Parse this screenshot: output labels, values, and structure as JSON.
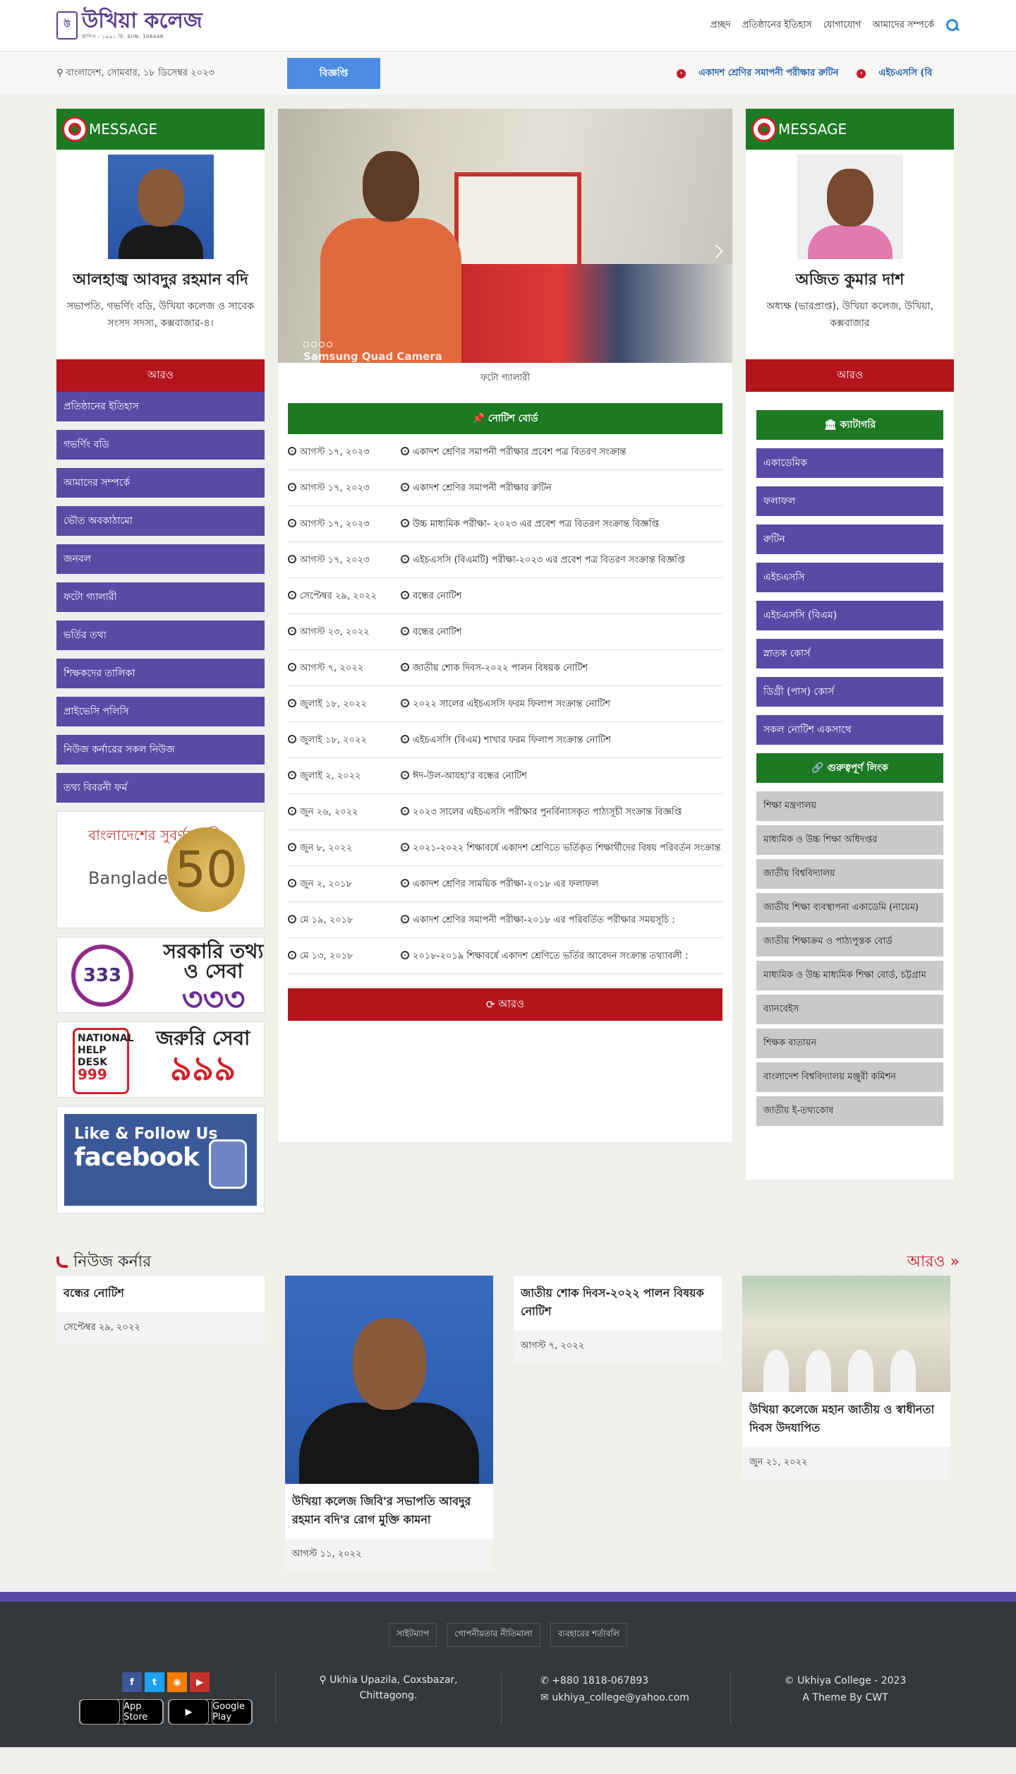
{
  "header": {
    "logo_text": "উখিয়া কলেজ",
    "logo_sub": "স্থাপিত - ১৯৯১ খ্রি. EIIN: 106446",
    "nav": [
      "প্রচ্ছদ",
      "প্রতিষ্ঠানের ইতিহাস",
      "যোগাযোগ",
      "আমাদের সম্পর্কে"
    ]
  },
  "strip": {
    "date": "বাংলাদেশ, সোমবার, ১৮ ডিসেম্বর ২০২৩",
    "badge": "বিজ্ঞপ্তি",
    "marquee": [
      "একাদশ শ্রেণির সমাপনী পরীক্ষার রুটিন",
      "এইচএসসি (বি"
    ]
  },
  "msg_left": {
    "header": "MESSAGE",
    "name": "আলহাজ্ব আবদুর রহমান বদি",
    "desc": "সভাপতি, গভর্ণিং বডি, উখিয়া কলেজ ও সাবেক সংসদ সদস্য, কক্সবাজার-৪।",
    "more": "আরও"
  },
  "msg_right": {
    "header": "MESSAGE",
    "name": "অজিত কুমার দাশ",
    "desc": "অধ্যক্ষ (ভারপ্রাপ্ত), উখিয়া কলেজ, উখিয়া, কক্সবাজার",
    "more": "আরও"
  },
  "slider": {
    "caption_overlay": "Samsung Quad Camera",
    "caption": "ফটো গ্যালারী"
  },
  "left_links": [
    "প্রতিষ্ঠানের ইতিহাস",
    "গভর্ণিং বডি",
    "আমাদের সম্পর্কে",
    "ভৌত অবকাঠামো",
    "জনবল",
    "ফটো গ্যালারী",
    "ভর্তির তথ্য",
    "শিক্ষকদের তালিকা",
    "প্রাইভেসি পলিসি",
    "নিউজ কর্নারের সকল নিউজ",
    "তথ্য বিবরনী ফর্ম"
  ],
  "ads": {
    "b50_line1": "বাংলাদেশের সুবর্ণজয়ন্তী",
    "b50_line2": "Bangladesh",
    "b50_num": "50",
    "b333_ring": "333",
    "b333_title": "সরকারি তথ্য ও সেবা",
    "b333_num": "৩৩৩",
    "b999_box": "NATIONAL HELP DESK",
    "b999_box_num": "999",
    "b999_title": "জরুরি সেবা",
    "b999_num": "৯৯৯",
    "fb_line1": "Like & Follow Us",
    "fb_line2": "facebook"
  },
  "notice": {
    "header": "নোটিশ বোর্ড",
    "rows": [
      {
        "date": "আগস্ট ১৭, ২০২৩",
        "title": "একাদশ শ্রেণির সমাপনী পরীক্ষার প্রবেশ পত্র বিতরণ সংক্রান্ত"
      },
      {
        "date": "আগস্ট ১৭, ২০২৩",
        "title": "একাদশ শ্রেণির সমাপনী পরীক্ষার রুটিন"
      },
      {
        "date": "আগস্ট ১৭, ২০২৩",
        "title": "উচ্চ মাধ্যমিক পরীক্ষা- ২০২৩ এর প্রবেশ পত্র বিতরণ সংক্রান্ত বিজ্ঞপ্তি"
      },
      {
        "date": "আগস্ট ১৭, ২০২৩",
        "title": "এইচএসসি (বিএমটি) পরীক্ষা-২০২৩ এর প্রবেশ পত্র বিতরণ সংক্রান্ত বিজ্ঞপ্তি"
      },
      {
        "date": "সেপ্টেম্বর ২৯, ২০২২",
        "title": "বন্ধের নোটিশ"
      },
      {
        "date": "আগস্ট ২৩, ২০২২",
        "title": "বন্ধের নোটিশ"
      },
      {
        "date": "আগস্ট ৭, ২০২২",
        "title": "জাতীয় শোক দিবস-২০২২ পালন বিষয়ক নোটিশ"
      },
      {
        "date": "জুলাই ১৮, ২০২২",
        "title": "২০২২ সালের এইচএসসি ফরম ফিলাপ সংক্রান্ত নোটিশ"
      },
      {
        "date": "জুলাই ১৮, ২০২২",
        "title": "এইচএসসি (বিএম) শাখার ফরম ফিলাপ সংক্রান্ত নোটিশ"
      },
      {
        "date": "জুলাই ২, ২০২২",
        "title": "ঈদ-উল-আযহা'র বন্ধের নোটিশ"
      },
      {
        "date": "জুন ২৬, ২০২২",
        "title": "২০২৩ সালের এইচএসসি পরীক্ষার পুনর্বিন্যাসকৃত পাঠ্যসূচী সংক্রান্ত বিজ্ঞপ্তি"
      },
      {
        "date": "জুন ৮, ২০২২",
        "title": "২০২১-২০২২ শিক্ষাবর্ষে একাদশ শ্রেণিতে ভর্তিকৃত শিক্ষার্থীদের বিষয় পরিবর্তন সংক্রান্ত"
      },
      {
        "date": "জুন ২, ২০১৮",
        "title": "একাদশ শ্রেণির সাময়িক পরীক্ষা-২০১৮ এর ফলাফল"
      },
      {
        "date": "মে ১৯, ২০১৮",
        "title": "একাদশ শ্রেণির সমাপনী পরীক্ষা-২০১৮ এর পরিবর্তিত পরীক্ষার সময়সূচি :"
      },
      {
        "date": "মে ১৩, ২০১৮",
        "title": "২০১৮-২০১৯ শিক্ষাবর্ষে একাদশ শ্রেণিতে ভর্তির আবেদন সংক্রান্ত তথ্যাবলী :"
      }
    ],
    "more": "আরও"
  },
  "category": {
    "header": "ক্যাটাগরি",
    "items": [
      "একাডেমিক",
      "ফলাফল",
      "রুটিন",
      "এইচএসসি",
      "এইচএসসি (বিএম)",
      "স্নাতক কোর্স",
      "ডিগ্রী (পাস) কোর্স",
      "সকল নোটিশ একসাথে"
    ]
  },
  "links": {
    "header": "গুরুত্বপূর্ণ লিংক",
    "items": [
      "শিক্ষা মন্ত্রণালয়",
      "মাধ্যমিক ও উচ্চ শিক্ষা অধিদপ্তর",
      "জাতীয় বিশ্ববিদ্যালয়",
      "জাতীয় শিক্ষা ব্যবস্থাপনা একাডেমি (নায়েম)",
      "জাতীয় শিক্ষাক্রম ও পাঠ্যপুস্তক বোর্ড",
      "মাধ্যমিক ও উচ্চ মাধ্যমিক শিক্ষা বোর্ড, চট্টগ্রাম",
      "ব্যানবেইস",
      "শিক্ষক বাতায়ন",
      "বাংলাদেশ বিশ্ববিদ্যালয় মঞ্জুরী কমিশন",
      "জাতীয় ই-তথ্যকোষ"
    ]
  },
  "news": {
    "header": "নিউজ কর্নার",
    "more": "আরও »",
    "cards": [
      {
        "title": "বন্ধের নোটিশ",
        "date": "সেপ্টেম্বর ২৯, ২০২২"
      },
      {
        "title": "উখিয়া কলেজ জিবি'র সভাপতি আবদুর রহমান বদি'র রোগ মুক্তি কামনা",
        "date": "আগস্ট ১১, ২০২২"
      },
      {
        "title": "জাতীয় শোক দিবস-২০২২ পালন বিষয়ক নোটিশ",
        "date": "আগস্ট ৭, ২০২২"
      },
      {
        "title": "উখিয়া কলেজে মহান জাতীয় ও স্বাধীনতা দিবস উদযাপিত",
        "date": "জুন ২১, ২০২২"
      }
    ]
  },
  "footer": {
    "links": [
      "সাইটম্যাপ",
      "গোপনীয়তার নীতিমালা",
      "ব্যবহারের শর্তাবলি"
    ],
    "social": [
      "f",
      "t",
      "rss",
      "yt"
    ],
    "app_store": "App Store",
    "google_play": "Google Play",
    "address": "Ukhia Upazila, Coxsbazar, Chittagong.",
    "phone": "+880 1818-067893",
    "email": "ukhiya_college@yahoo.com",
    "copyright": "© Ukhiya College - 2023",
    "theme": "A Theme By CWT"
  }
}
